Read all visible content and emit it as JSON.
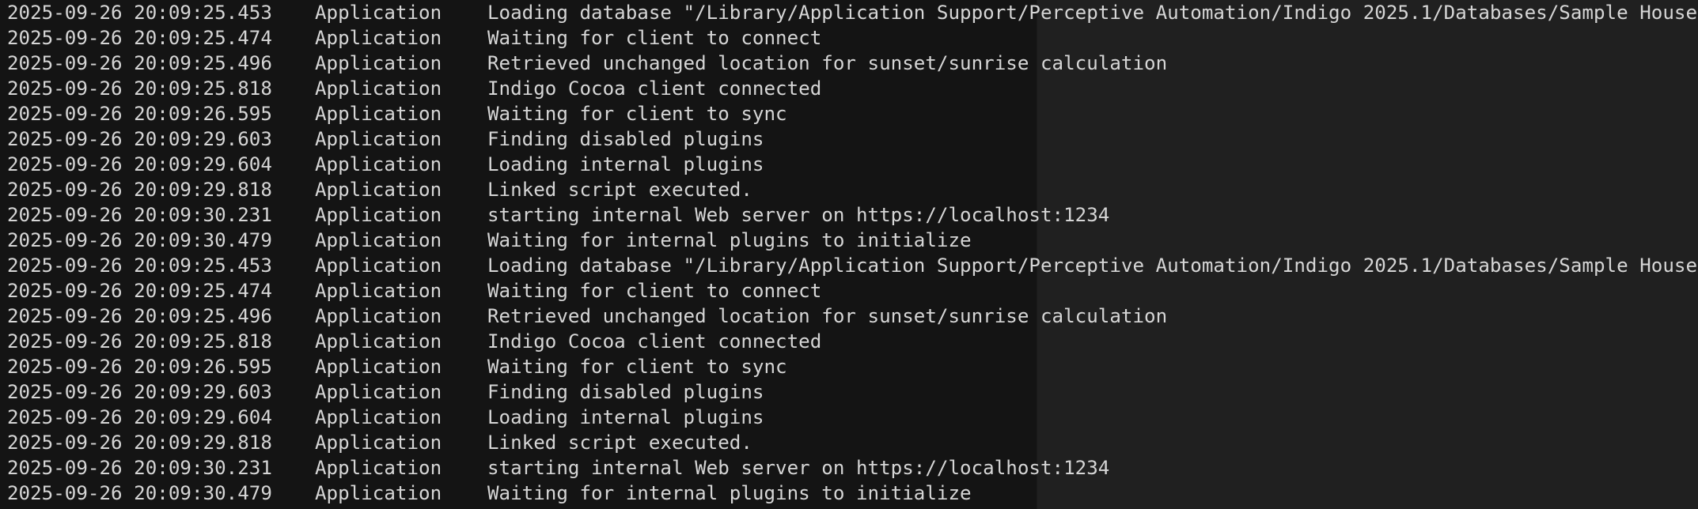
{
  "log": {
    "entries": [
      {
        "timestamp": "2025-09-26 20:09:25.453",
        "source": "Application",
        "message": "Loading database \"/Library/Application Support/Perceptive Automation/Indigo 2025.1/Databases/Sample House."
      },
      {
        "timestamp": "2025-09-26 20:09:25.474",
        "source": "Application",
        "message": "Waiting for client to connect"
      },
      {
        "timestamp": "2025-09-26 20:09:25.496",
        "source": "Application",
        "message": "Retrieved unchanged location for sunset/sunrise calculation"
      },
      {
        "timestamp": "2025-09-26 20:09:25.818",
        "source": "Application",
        "message": "Indigo Cocoa client connected"
      },
      {
        "timestamp": "2025-09-26 20:09:26.595",
        "source": "Application",
        "message": "Waiting for client to sync"
      },
      {
        "timestamp": "2025-09-26 20:09:29.603",
        "source": "Application",
        "message": "Finding disabled plugins"
      },
      {
        "timestamp": "2025-09-26 20:09:29.604",
        "source": "Application",
        "message": "Loading internal plugins"
      },
      {
        "timestamp": "2025-09-26 20:09:29.818",
        "source": "Application",
        "message": "Linked script executed."
      },
      {
        "timestamp": "2025-09-26 20:09:30.231",
        "source": "Application",
        "message": "starting internal Web server on https://localhost:1234"
      },
      {
        "timestamp": "2025-09-26 20:09:30.479",
        "source": "Application",
        "message": "Waiting for internal plugins to initialize"
      },
      {
        "timestamp": "2025-09-26 20:09:25.453",
        "source": "Application",
        "message": "Loading database \"/Library/Application Support/Perceptive Automation/Indigo 2025.1/Databases/Sample House."
      },
      {
        "timestamp": "2025-09-26 20:09:25.474",
        "source": "Application",
        "message": "Waiting for client to connect"
      },
      {
        "timestamp": "2025-09-26 20:09:25.496",
        "source": "Application",
        "message": "Retrieved unchanged location for sunset/sunrise calculation"
      },
      {
        "timestamp": "2025-09-26 20:09:25.818",
        "source": "Application",
        "message": "Indigo Cocoa client connected"
      },
      {
        "timestamp": "2025-09-26 20:09:26.595",
        "source": "Application",
        "message": "Waiting for client to sync"
      },
      {
        "timestamp": "2025-09-26 20:09:29.603",
        "source": "Application",
        "message": "Finding disabled plugins"
      },
      {
        "timestamp": "2025-09-26 20:09:29.604",
        "source": "Application",
        "message": "Loading internal plugins"
      },
      {
        "timestamp": "2025-09-26 20:09:29.818",
        "source": "Application",
        "message": "Linked script executed."
      },
      {
        "timestamp": "2025-09-26 20:09:30.231",
        "source": "Application",
        "message": "starting internal Web server on https://localhost:1234"
      },
      {
        "timestamp": "2025-09-26 20:09:30.479",
        "source": "Application",
        "message": "Waiting for internal plugins to initialize"
      }
    ]
  }
}
